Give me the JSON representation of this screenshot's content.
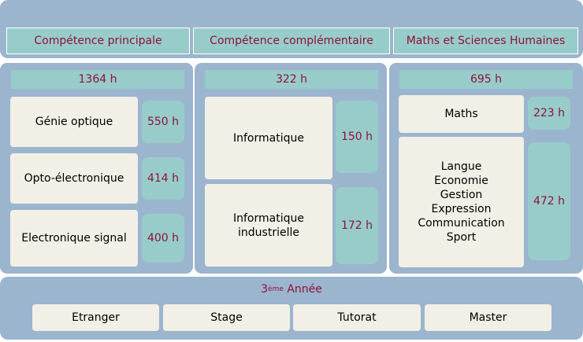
{
  "headers": [
    {
      "label": "Compétence principale"
    },
    {
      "label": "Compétence complémentaire"
    },
    {
      "label": "Maths et Sciences Humaines"
    }
  ],
  "columns": [
    {
      "total": "1364 h",
      "items": [
        {
          "name": "Génie optique",
          "hours": "550 h"
        },
        {
          "name": "Opto-électronique",
          "hours": "414 h"
        },
        {
          "name": "Electronique signal",
          "hours": "400 h"
        }
      ]
    },
    {
      "total": "322 h",
      "items": [
        {
          "name": "Informatique",
          "hours": "150 h"
        },
        {
          "name_lines": [
            "Informatique",
            "industrielle"
          ],
          "hours": "172 h"
        }
      ]
    },
    {
      "total": "695 h",
      "items": [
        {
          "name": "Maths",
          "hours": "223 h"
        },
        {
          "name_lines": [
            "Langue",
            "Economie",
            "Gestion",
            "Expression",
            "Communication",
            "Sport"
          ],
          "hours": "472 h"
        }
      ]
    }
  ],
  "third_year": {
    "prefix": "3",
    "suffix": "ème",
    "rest": " Année",
    "options": [
      "Etranger",
      "Stage",
      "Tutorat",
      "Master"
    ]
  }
}
